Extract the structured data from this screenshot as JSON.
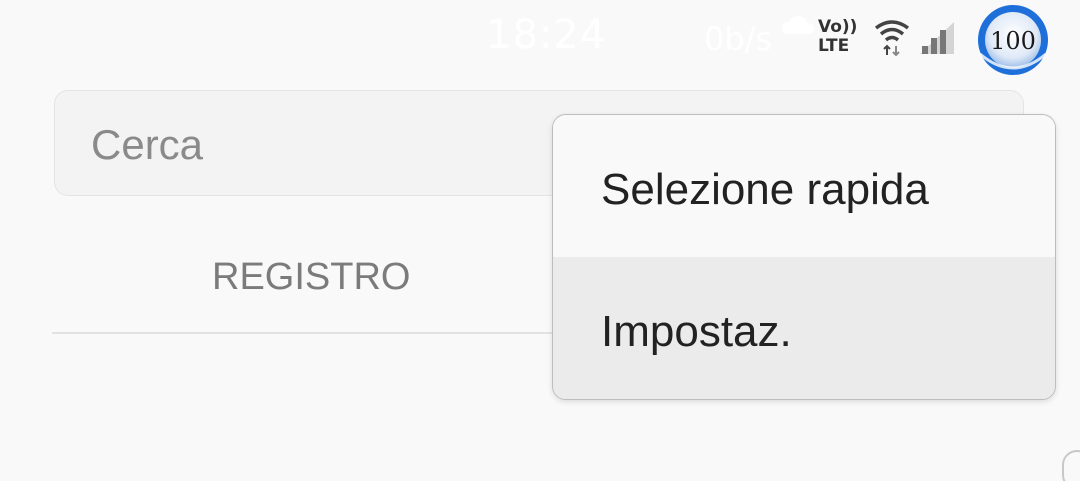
{
  "status_bar": {
    "time": "18:24",
    "network_speed": "0b/s",
    "volte_label_top": "Vo))",
    "volte_label_bottom": "LTE",
    "battery_level": "100",
    "icons": [
      "cloud-icon",
      "volte-icon",
      "wifi-icon",
      "signal-icon",
      "battery-icon"
    ]
  },
  "search": {
    "placeholder": "Cerca"
  },
  "tabs": [
    {
      "label": "REGISTRO"
    }
  ],
  "popup_menu": {
    "items": [
      {
        "label": "Selezione rapida"
      },
      {
        "label": "Impostaz."
      }
    ]
  },
  "colors": {
    "background": "#f9f9f9",
    "search_bg": "#f3f3f3",
    "menu_highlight": "#ebebeb",
    "text_primary": "#222222",
    "text_secondary": "#8a8a8a",
    "battery_accent": "#1e6fd9"
  }
}
